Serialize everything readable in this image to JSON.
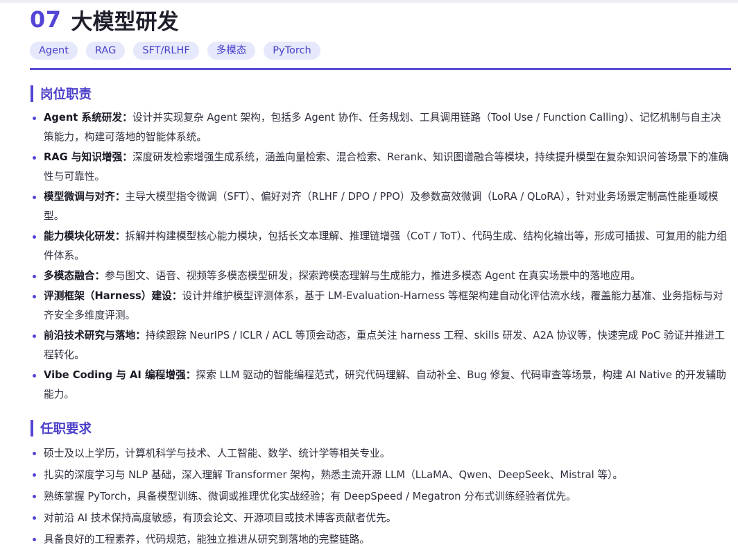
{
  "header": {
    "number": "07",
    "title": "大模型研发"
  },
  "tags": [
    "Agent",
    "RAG",
    "SFT/RLHF",
    "多模态",
    "PyTorch"
  ],
  "responsibilities": {
    "heading": "岗位职责",
    "items": [
      {
        "label": "Agent 系统研发：",
        "text": "设计并实现复杂 Agent 架构，包括多 Agent 协作、任务规划、工具调用链路（Tool Use / Function Calling）、记忆机制与自主决策能力，构建可落地的智能体系统。"
      },
      {
        "label": "RAG 与知识增强：",
        "text": "深度研发检索增强生成系统，涵盖向量检索、混合检索、Rerank、知识图谱融合等模块，持续提升模型在复杂知识问答场景下的准确性与可靠性。"
      },
      {
        "label": "模型微调与对齐：",
        "text": "主导大模型指令微调（SFT）、偏好对齐（RLHF / DPO / PPO）及参数高效微调（LoRA / QLoRA），针对业务场景定制高性能垂域模型。"
      },
      {
        "label": "能力模块化研发：",
        "text": "拆解并构建模型核心能力模块，包括长文本理解、推理链增强（CoT / ToT）、代码生成、结构化输出等，形成可插拔、可复用的能力组件体系。"
      },
      {
        "label": "多模态融合：",
        "text": "参与图文、语音、视频等多模态模型研发，探索跨模态理解与生成能力，推进多模态 Agent 在真实场景中的落地应用。"
      },
      {
        "label": "评测框架（Harness）建设：",
        "text": "设计并维护模型评测体系，基于 LM-Evaluation-Harness 等框架构建自动化评估流水线，覆盖能力基准、业务指标与对齐安全多维度评测。"
      },
      {
        "label": "前沿技术研究与落地：",
        "text": "持续跟踪 NeurIPS / ICLR / ACL 等顶会动态，重点关注 harness 工程、skills 研发、A2A 协议等，快速完成 PoC 验证并推进工程转化。"
      },
      {
        "label": "Vibe Coding 与 AI 编程增强：",
        "text": "探索 LLM 驱动的智能编程范式，研究代码理解、自动补全、Bug 修复、代码审查等场景，构建 AI Native 的开发辅助能力。"
      }
    ]
  },
  "requirements": {
    "heading": "任职要求",
    "items": [
      "硕士及以上学历，计算机科学与技术、人工智能、数学、统计学等相关专业。",
      "扎实的深度学习与 NLP 基础，深入理解 Transformer 架构，熟悉主流开源 LLM（LLaMA、Qwen、DeepSeek、Mistral 等）。",
      "熟练掌握 PyTorch，具备模型训练、微调或推理优化实战经验；有 DeepSpeed / Megatron 分布式训练经验者优先。",
      "对前沿 AI 技术保持高度敏感，有顶会论文、开源项目或技术博客贡献者优先。",
      "具备良好的工程素养，代码规范，能独立推进从研究到落地的完整链路。"
    ]
  }
}
